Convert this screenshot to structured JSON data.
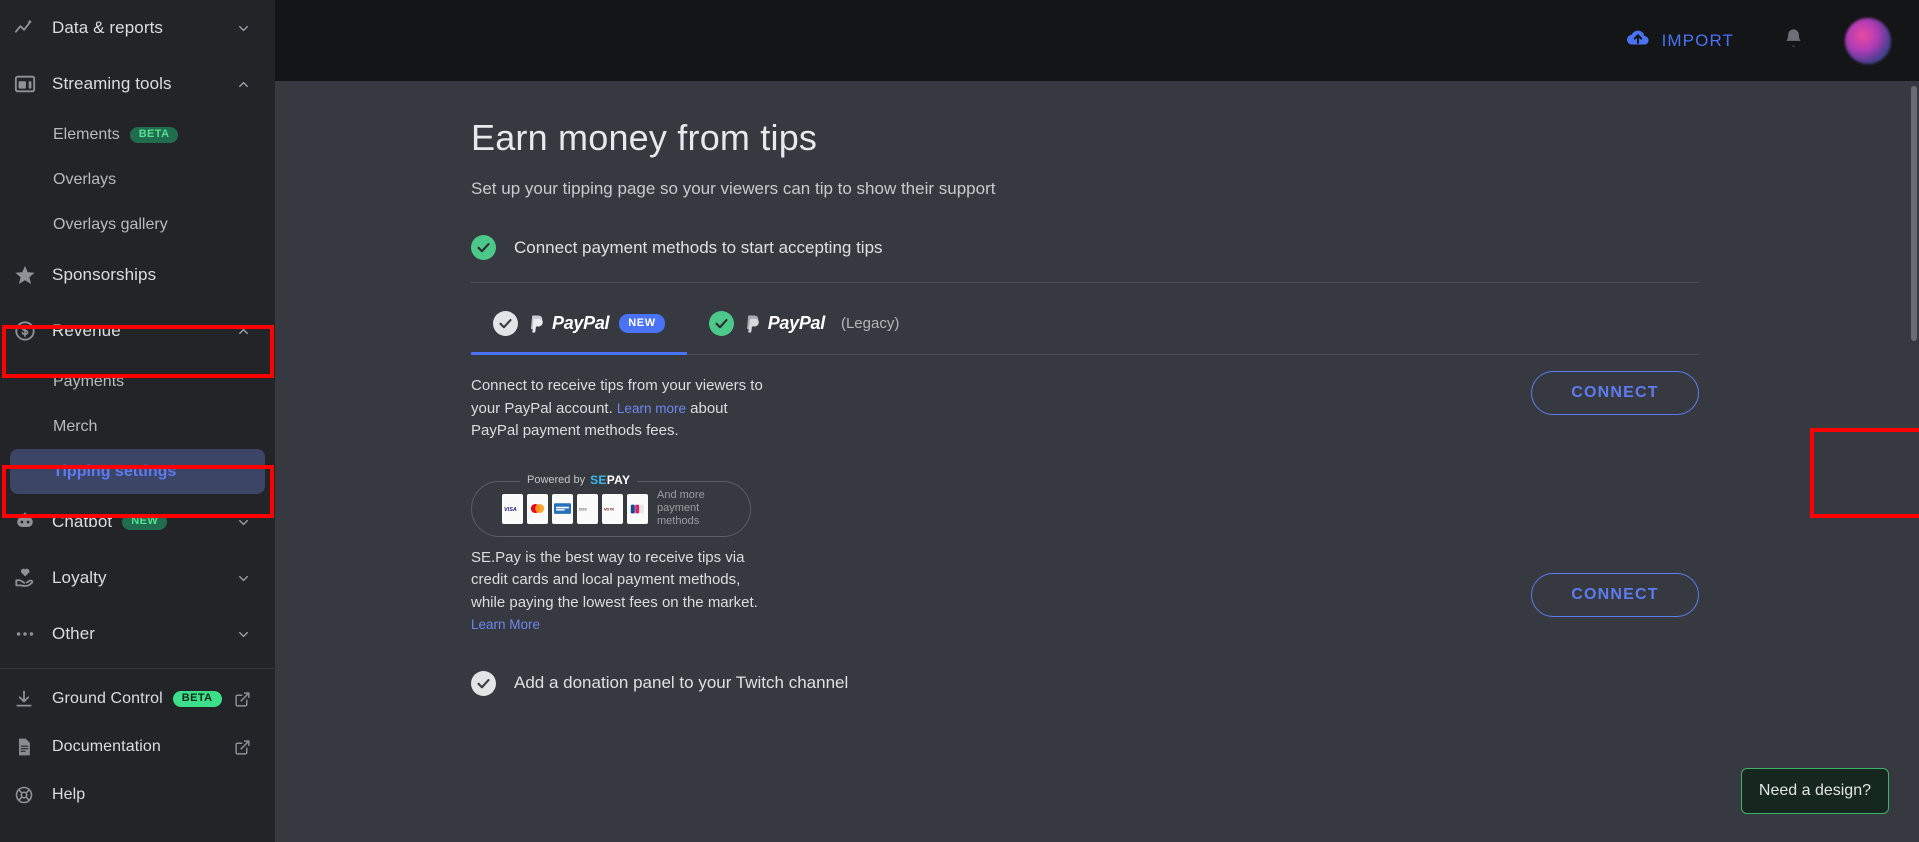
{
  "topbar": {
    "import_label": "IMPORT",
    "import_icon": "cloud-upload-icon",
    "bell_icon": "notification-bell-icon",
    "avatar_name": "user-avatar",
    "accent_blue": "#4a72f5"
  },
  "sidebar": {
    "items": [
      {
        "label": "Data & reports",
        "icon": "analytics-icon",
        "chevron": "down",
        "type": "group"
      },
      {
        "label": "Streaming tools",
        "icon": "layout-icon",
        "chevron": "up",
        "type": "group"
      },
      {
        "label": "Elements",
        "badge": "BETA",
        "type": "sub"
      },
      {
        "label": "Overlays",
        "type": "sub"
      },
      {
        "label": "Overlays gallery",
        "type": "sub"
      },
      {
        "label": "Sponsorships",
        "icon": "star-icon",
        "type": "group"
      },
      {
        "label": "Revenue",
        "icon": "dollar-coin-icon",
        "chevron": "up",
        "type": "group",
        "highlighted": true
      },
      {
        "label": "Payments",
        "type": "sub"
      },
      {
        "label": "Merch",
        "type": "sub"
      },
      {
        "label": "Tipping settings",
        "type": "sub",
        "active": true,
        "highlighted": true
      },
      {
        "label": "Chatbot",
        "icon": "robot-icon",
        "badge": "NEW",
        "chevron": "down",
        "type": "group"
      },
      {
        "label": "Loyalty",
        "icon": "heart-hand-icon",
        "chevron": "down",
        "type": "group"
      },
      {
        "label": "Other",
        "icon": "ellipsis-icon",
        "chevron": "down",
        "type": "group"
      }
    ],
    "footer": [
      {
        "label": "Ground Control",
        "icon": "download-icon",
        "badge": "BETA",
        "external": true
      },
      {
        "label": "Documentation",
        "icon": "document-icon",
        "external": true
      },
      {
        "label": "Help",
        "icon": "help-circle-icon",
        "external": false
      }
    ],
    "active_color": "#5f7bf0",
    "highlight_color": "#ff0000"
  },
  "page": {
    "title": "Earn money from tips",
    "subtitle": "Set up your tipping page so your viewers can tip to show their support",
    "step_one": "Connect payment methods to start accepting tips",
    "step_one_state": "complete",
    "step_two": "Add a donation panel to your Twitch channel",
    "step_two_state": "incomplete"
  },
  "tabs": [
    {
      "label": "PayPal",
      "badge": "NEW",
      "active": true,
      "check_state": "grey"
    },
    {
      "label": "PayPal",
      "suffix": "(Legacy)",
      "active": false,
      "check_state": "green"
    }
  ],
  "paypal": {
    "desc_part1": "Connect to receive tips from your viewers to your PayPal account. ",
    "link1": "Learn more",
    "desc_part2": " about PayPal payment methods fees.",
    "connect_label": "CONNECT"
  },
  "sepay": {
    "powered_by": "Powered by",
    "brand": "SE.PAY",
    "brand_se": "SE",
    "brand_pay": "PAY",
    "and_more": "And more payment methods",
    "cards": [
      "visa",
      "mastercard",
      "amex",
      "discover",
      "maestro",
      "jcb"
    ],
    "desc": "SE.Pay is the best way to receive tips via credit cards and local payment methods, while paying the lowest fees on the market. ",
    "link": "Learn More",
    "connect_label": "CONNECT"
  },
  "floating": {
    "need_design_label": "Need a design?",
    "border_color": "#3fb06a"
  }
}
